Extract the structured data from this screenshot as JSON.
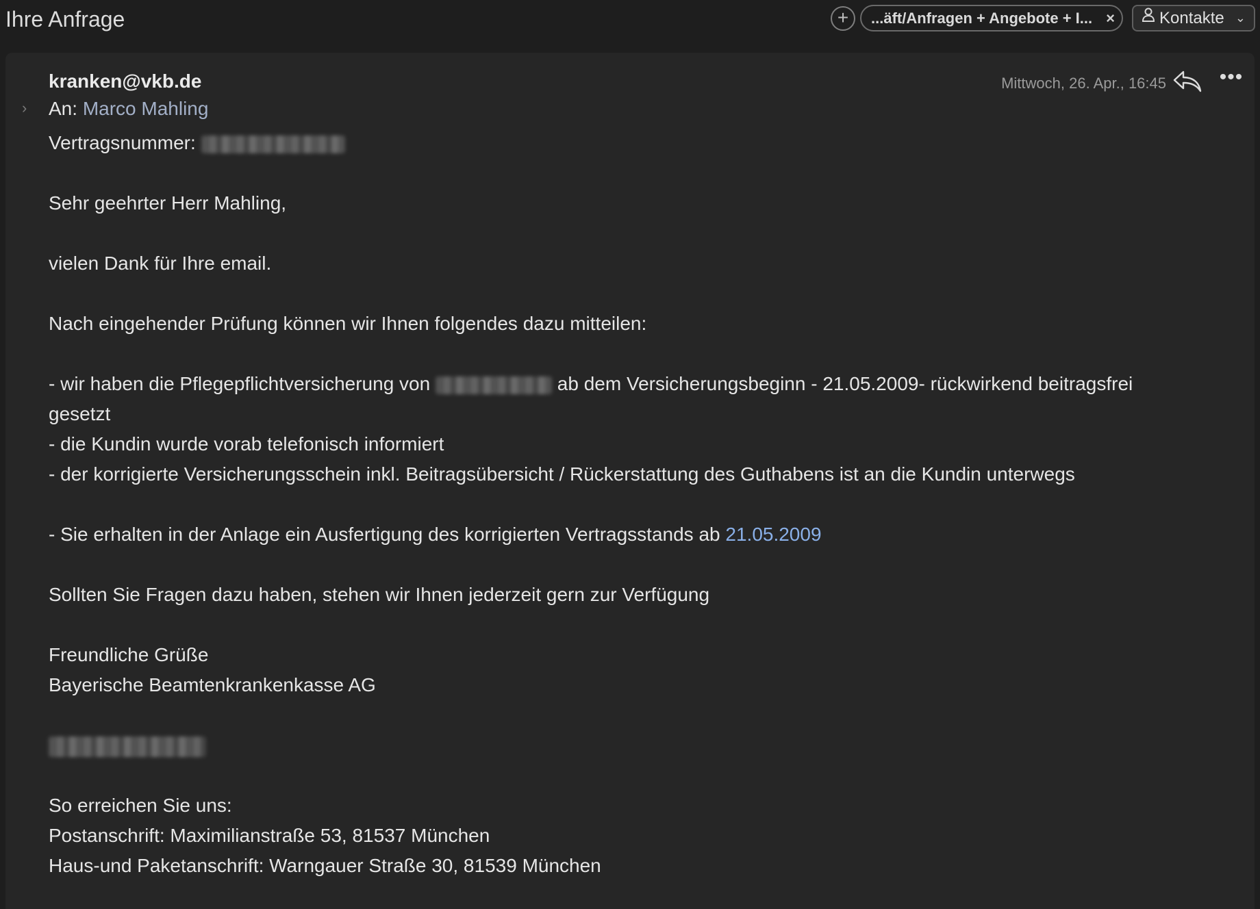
{
  "window": {
    "title": "Ihre Anfrage"
  },
  "toolbar": {
    "add_icon": "plus-circle-icon",
    "folder_chip_label": "...äft/Anfragen + Angebote + I...",
    "folder_chip_close": "×",
    "contacts_label": "Kontakte",
    "contacts_icon": "person-icon",
    "contacts_chevron": "⌄"
  },
  "message": {
    "sender": "kranken@vkb.de",
    "to_label": "An:",
    "to_name": "Marco Mahling",
    "date": "Mittwoch, 26. Apr., 16:45",
    "reply_icon": "reply-icon",
    "more_icon": "more-icon",
    "more_glyph": "•••"
  },
  "body": {
    "contract_label": "Vertragsnummer:",
    "greeting": "Sehr geehrter Herr Mahling,",
    "thanks": "vielen Dank für Ihre email.",
    "intro": "Nach eingehender Prüfung können wir Ihnen folgendes dazu mitteilen:",
    "bullet1_part1": "- wir haben die Pflegepflichtversicherung von",
    "bullet1_part2": "ab dem Versicherungsbeginn - 21.05.2009- rückwirkend beitragsfrei",
    "bullet1_part3": "gesetzt",
    "bullet2": "- die Kundin wurde vorab telefonisch informiert",
    "bullet3": "- der korrigierte Versicherungsschein inkl. Beitragsübersicht / Rückerstattung des Guthabens ist an die Kundin unterwegs",
    "bullet4_part1": "- Sie erhalten in der Anlage ein Ausfertigung des korrigierten Vertragsstands ab",
    "bullet4_date": "21.05.2009",
    "questions": "Sollten Sie Fragen dazu haben, stehen wir Ihnen jederzeit gern zur Verfügung",
    "closing": "Freundliche Grüße",
    "company": "Bayerische Beamtenkrankenkasse AG",
    "contact_heading": "So erreichen Sie uns:",
    "postal": "Postanschrift: Maximilianstraße 53, 81537 München",
    "parcel": "Haus-und Paketanschrift: Warngauer Straße 30, 81539 München"
  },
  "colors": {
    "background": "#1e1e1e",
    "panel": "#262626",
    "text": "#e6e6e6",
    "link": "#8ab0e8",
    "recipient": "#a3b0c8",
    "muted": "#9a9a9a"
  }
}
